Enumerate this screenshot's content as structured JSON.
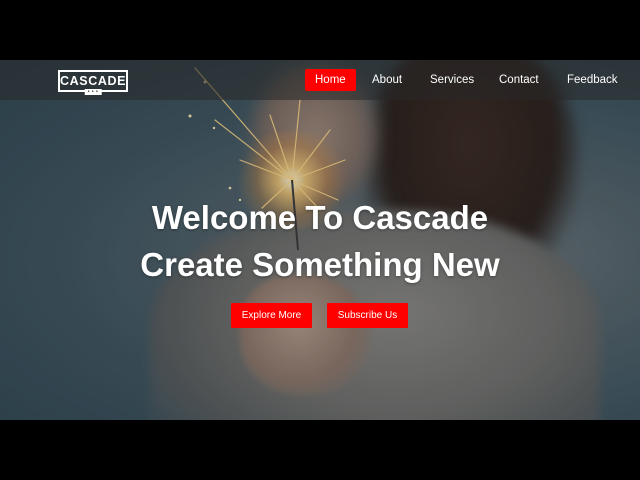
{
  "logo": {
    "text": "CASCADE",
    "tag": "• • •"
  },
  "nav": {
    "items": [
      {
        "label": "Home"
      },
      {
        "label": "About"
      },
      {
        "label": "Services"
      },
      {
        "label": "Contact"
      },
      {
        "label": "Feedback"
      }
    ],
    "active": "Home"
  },
  "hero": {
    "line1": "Welcome To Cascade",
    "line2": "Create Something New",
    "buttons": {
      "explore": "Explore More",
      "subscribe": "Subscribe Us"
    }
  },
  "colors": {
    "accent": "#ff0000",
    "navbar": "rgba(40,40,40,0.55)",
    "text": "#ffffff"
  },
  "icons": {
    "background": "sparkler-photo"
  }
}
